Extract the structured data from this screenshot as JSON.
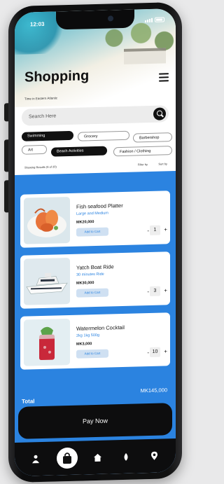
{
  "status": {
    "time": "12:03"
  },
  "header": {
    "title": "Shopping",
    "subtitle": "Time in Eastern Atlantic"
  },
  "search": {
    "placeholder": "Search Here"
  },
  "chips": [
    "Swimming",
    "Grocery",
    "Barbershop",
    "Art",
    "Beach Activities",
    "Fashion / Clothing"
  ],
  "results": {
    "count_text": "Showing Results (6 of 20)",
    "filter_label": "Filter by",
    "sort_label": "Sort by"
  },
  "products": [
    {
      "name": "Fish seafood Platter",
      "desc": "Large and Medium",
      "price": "MK20,000",
      "add_label": "Add to Cart",
      "qty": "1"
    },
    {
      "name": "Yatch Boat Ride",
      "desc": "30 minutes Ride",
      "price": "MK30,000",
      "add_label": "Add to Cart",
      "qty": "3"
    },
    {
      "name": "Watermelon Cocktail",
      "desc": "2kg 1kg 500g",
      "price": "MK3,000",
      "add_label": "Add to Cart",
      "qty": "10"
    }
  ],
  "summary": {
    "total_label": "Total",
    "total_value": "MK145,000"
  },
  "pay": {
    "label": "Pay Now"
  },
  "nav": [
    {
      "icon": "person-icon"
    },
    {
      "icon": "shopping-bag-icon"
    },
    {
      "icon": "home-icon"
    },
    {
      "icon": "drop-icon"
    },
    {
      "icon": "location-pin-icon"
    }
  ],
  "colors": {
    "accent": "#2b83e0",
    "dark": "#0d0d0e"
  }
}
